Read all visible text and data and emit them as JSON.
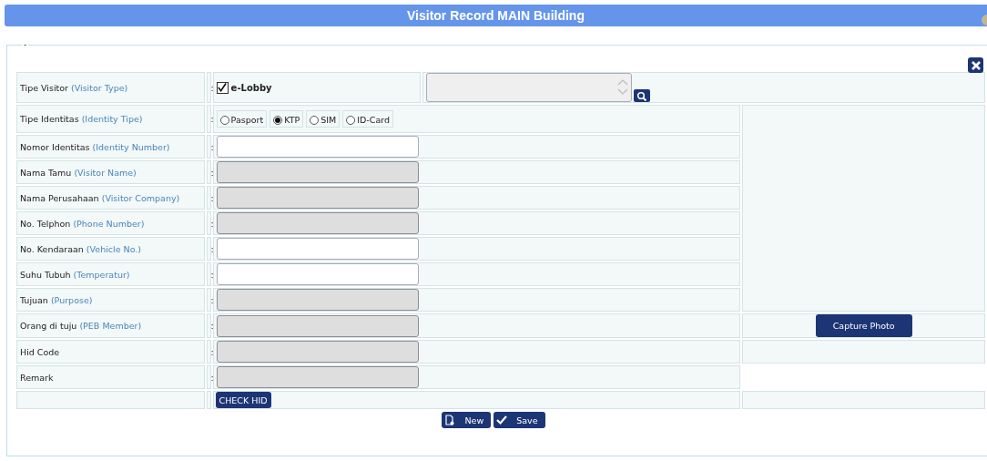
{
  "header": {
    "title": "Visitor Record MAIN Building"
  },
  "legend": "-",
  "rows": [
    {
      "kind": "visitor_type",
      "label": "Tipe Visitor",
      "hint": "(Visitor Type)",
      "colon": ":",
      "option": {
        "label": "e-Lobby",
        "checked": true
      }
    },
    {
      "kind": "radio",
      "label": "Tipe Identitas",
      "hint": "(Identity Tipe)",
      "colon": ":",
      "side": {
        "kind": "photo"
      },
      "options": [
        {
          "label": "Pasport",
          "selected": false
        },
        {
          "label": "KTP",
          "selected": true
        },
        {
          "label": "SIM",
          "selected": false
        },
        {
          "label": "ID-Card",
          "selected": false
        }
      ]
    },
    {
      "kind": "input",
      "label": "Nomor Identitas",
      "hint": "(Identity Number)",
      "colon": ":",
      "disabled": false
    },
    {
      "kind": "input",
      "label": "Nama Tamu",
      "hint": "(Visitor Name)",
      "colon": ":",
      "disabled": true
    },
    {
      "kind": "input",
      "label": "Nama Perusahaan",
      "hint": "(Visitor Company)",
      "colon": ":",
      "disabled": true
    },
    {
      "kind": "input",
      "label": "No. Telphon",
      "hint": "(Phone Number)",
      "colon": ":",
      "disabled": true
    },
    {
      "kind": "input",
      "label": "No. Kendaraan",
      "hint": "(Vehicle No.)",
      "colon": ":",
      "disabled": false
    },
    {
      "kind": "input",
      "label": "Suhu Tubuh",
      "hint": "(Temperatur)",
      "colon": ":",
      "disabled": false
    },
    {
      "kind": "input",
      "label": "Tujuan",
      "hint": "(Purpose)",
      "colon": ":",
      "disabled": true
    },
    {
      "kind": "input",
      "label": "Orang di tuju",
      "hint": "(PEB Member)",
      "colon": ":",
      "disabled": true,
      "side": {
        "kind": "button",
        "label": "Capture Photo"
      }
    },
    {
      "kind": "input",
      "label": "Hid Code",
      "colon": ":",
      "disabled": true,
      "side": {
        "kind": "empty"
      }
    },
    {
      "kind": "input",
      "label": "Remark",
      "colon": ":",
      "disabled": true,
      "side": {
        "kind": "none"
      }
    },
    {
      "kind": "action",
      "button": "CHECK HID",
      "side": {
        "kind": "empty"
      }
    }
  ],
  "footer_buttons": [
    {
      "kind": "new",
      "label": "New"
    },
    {
      "kind": "save",
      "label": "Save"
    }
  ]
}
